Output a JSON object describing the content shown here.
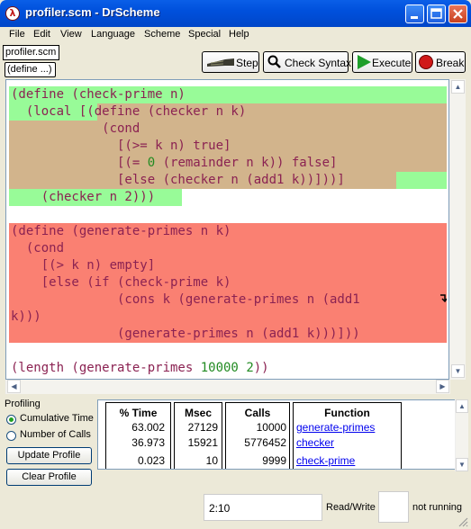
{
  "window": {
    "title": "profiler.scm - DrScheme",
    "app_icon_glyph": "λ",
    "controls": {
      "minimize": "minimize-icon",
      "maximize": "maximize-icon",
      "close": "close-icon"
    }
  },
  "menu": [
    "File",
    "Edit",
    "View",
    "Language",
    "Scheme",
    "Special",
    "Help"
  ],
  "file_tab": "profiler.scm",
  "define_menu": "(define ...)",
  "toolbar": {
    "step": "Step",
    "check_syntax": "Check Syntax",
    "execute": "Execute",
    "break": "Break"
  },
  "code": {
    "l1": "(define (check-prime n)",
    "l2": "  (local [(define (checker n k)",
    "l3": "            (cond",
    "l4": "              [(>= k n) true]",
    "l5a": "              [(= ",
    "l5n": "0",
    "l5b": " (remainder n k)) false]",
    "l6": "              [else (checker n (add1 k))]))]",
    "l7": "    (checker n 2)))",
    "l9": "(define (generate-primes n k)",
    "l10": "  (cond",
    "l11": "    [(> k n) empty]",
    "l12": "    [else (if (check-prime k)",
    "l13": "              (cons k (generate-primes n (add1",
    "l14": "k)))",
    "l15": "              (generate-primes n (add1 k)))]))",
    "l17a": "(length (generate-primes ",
    "l17n1": "10000",
    "l17sp": " ",
    "l17n2": "2",
    "l17b": "))"
  },
  "profiling": {
    "title": "Profiling",
    "options": [
      "Cumulative Time",
      "Number of Calls"
    ],
    "selected": "Cumulative Time",
    "update_button": "Update Profile",
    "clear_button": "Clear Profile",
    "headers": [
      "% Time",
      "Msec",
      "Calls",
      "Function"
    ],
    "rows": [
      {
        "pct": "63.002",
        "msec": "27129",
        "calls": "10000",
        "function": "generate-primes"
      },
      {
        "pct": "36.973",
        "msec": "15921",
        "calls": "5776452",
        "function": "checker"
      },
      {
        "pct": "0.023",
        "msec": "10",
        "calls": "9999",
        "function": "check-prime"
      }
    ]
  },
  "status": {
    "position": "2:10",
    "mode": "Read/Write",
    "running": "not running"
  },
  "colors": {
    "green_highlight": "#98FB98",
    "tan_highlight": "#D2B48C",
    "red_highlight": "#FA8072",
    "keyword": "#8B2252",
    "number": "#228B22"
  }
}
